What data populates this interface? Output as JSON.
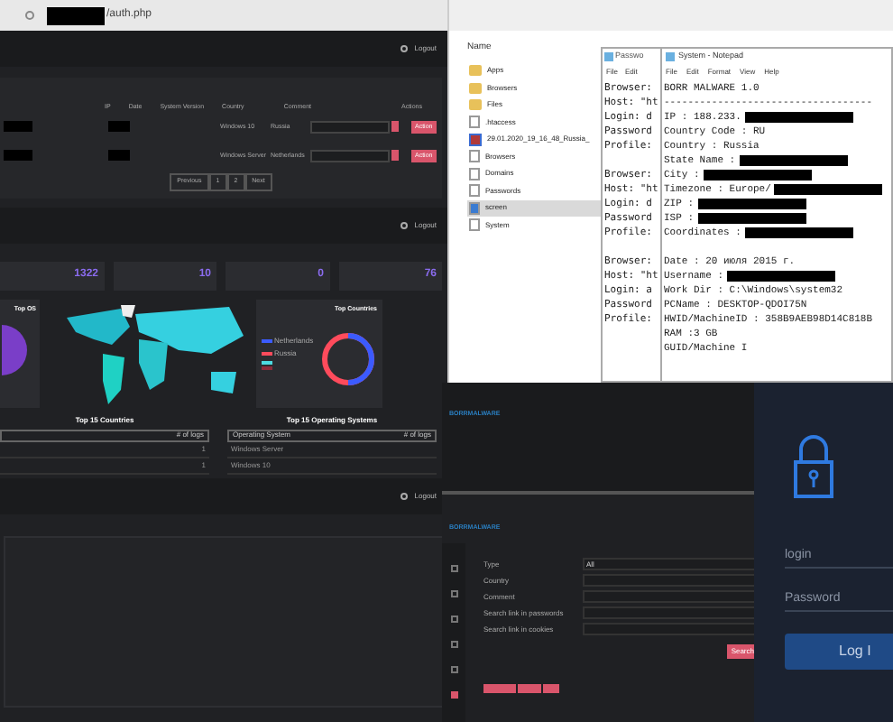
{
  "browser": {
    "url": "/auth.php"
  },
  "dashboard": {
    "logout": "Logout",
    "logs_table": {
      "columns": [
        "IP",
        "Date",
        "System Version",
        "Country",
        "Comment",
        "Actions"
      ],
      "rows": [
        {
          "system": "Windows 10",
          "country": "Russia",
          "action": "Action"
        },
        {
          "system": "Windows Server",
          "country": "Netherlands",
          "action": "Action"
        }
      ],
      "pagination": [
        "Previous",
        "1",
        "2",
        "Next"
      ]
    },
    "stats": [
      "1322",
      "10",
      "0",
      "76"
    ],
    "logout_1": "Logout",
    "top_os_title": "Top OS",
    "top_countries_title": "Top Countries",
    "legend": [
      {
        "label": "Netherlands",
        "color": "#3b5bff"
      },
      {
        "label": "Russia",
        "color": "#ff4b5c"
      },
      {
        "color": "#4dd9e0"
      },
      {
        "color": "#8b2b3a"
      }
    ],
    "tables": [
      {
        "title": "Top 15 Countries",
        "header": "# of logs",
        "rows": [
          "1",
          "1"
        ]
      },
      {
        "title": "Top 15 Operating Systems",
        "header": "# of logs",
        "first_column": "Operating System",
        "rows": [
          "Windows Server",
          "Windows 10"
        ]
      }
    ],
    "logout_2": "Logout"
  },
  "explorer": {
    "header": "Name",
    "items": [
      {
        "name": "Apps",
        "kind": "folder",
        "selected": false
      },
      {
        "name": "Browsers",
        "kind": "folder",
        "selected": false
      },
      {
        "name": "Files",
        "kind": "folder",
        "selected": false
      },
      {
        "name": ".htaccess",
        "kind": "file",
        "selected": false
      },
      {
        "name": "29.01.2020_19_16_48_Russia_",
        "kind": "archive",
        "selected": false
      },
      {
        "name": "Browsers",
        "kind": "file",
        "selected": false
      },
      {
        "name": "Domains",
        "kind": "file",
        "selected": false
      },
      {
        "name": "Passwords",
        "kind": "file",
        "selected": false
      },
      {
        "name": "screen",
        "kind": "image",
        "selected": true
      },
      {
        "name": "System",
        "kind": "file",
        "selected": false
      }
    ]
  },
  "passwords_notepad": {
    "title": "Passwo",
    "menu": [
      "File",
      "Edit"
    ],
    "sections": [
      [
        "Browser:",
        "Host: \"ht",
        "Login: d",
        "Password",
        "Profile:"
      ],
      [
        "Browser:",
        "Host: \"ht",
        "Login: d",
        "Password",
        "Profile:"
      ],
      [
        "Browser:",
        "Host: \"ht",
        "Login: a",
        "Password",
        "Profile:"
      ]
    ]
  },
  "system_notepad": {
    "title": "System - Notepad",
    "menu": [
      "File",
      "Edit",
      "Format",
      "View",
      "Help"
    ],
    "sections": [
      [
        {
          "text": "BORR MALWARE 1.0",
          "redacted": false
        },
        {
          "text": "-----------------------------------",
          "redacted": false
        },
        {
          "text": "IP : 188.233.",
          "redacted": true
        },
        {
          "text": "Country Code : RU",
          "redacted": false
        },
        {
          "text": "Country : Russia",
          "redacted": false
        },
        {
          "text": "State Name :",
          "redacted": true
        },
        {
          "text": "City :",
          "redacted": true
        },
        {
          "text": "Timezone : Europe/",
          "redacted": true
        },
        {
          "text": "ZIP :",
          "redacted": true
        },
        {
          "text": "ISP :",
          "redacted": true
        },
        {
          "text": "Coordinates :",
          "redacted": true
        }
      ],
      [
        {
          "text": "Date : 20 июля 2015 г.",
          "redacted": false
        },
        {
          "text": "Username :",
          "redacted": true
        },
        {
          "text": "Work Dir : C:\\Windows\\system32",
          "redacted": false
        },
        {
          "text": "PCName : DESKTOP-QDOI75N",
          "redacted": false
        },
        {
          "text": "HWID/MachineID : 358B9AEB98D14C818B",
          "redacted": false
        },
        {
          "text": "RAM :3 GB",
          "redacted": false
        },
        {
          "text": "GUID/Machine I",
          "redacted": false
        }
      ]
    ]
  },
  "admin_panel": {
    "brand": "BORRMALWARE",
    "brand_2": "BORRMALWARE",
    "form": [
      {
        "label": "Type",
        "value": "All"
      },
      {
        "label": "Country"
      },
      {
        "label": "Comment"
      },
      {
        "label": "Search link in passwords"
      },
      {
        "label": "Search link in cookies"
      }
    ],
    "search_button": "Search"
  },
  "login": {
    "login_placeholder": "login",
    "password_placeholder": "Password",
    "button": "Log I"
  }
}
